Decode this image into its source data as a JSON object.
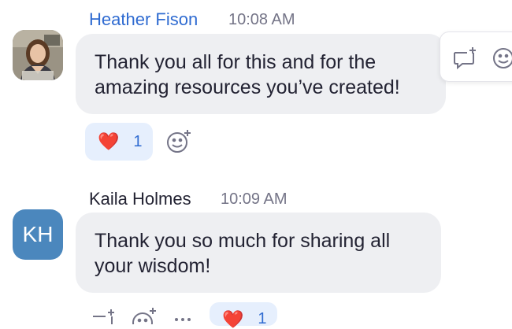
{
  "messages": [
    {
      "sender": "Heather Fison",
      "time": "10:08 AM",
      "text_lines": [
        "Thank you all for this and for the",
        "amazing resources you’ve created!"
      ],
      "reaction": {
        "emoji": "❤️",
        "count": "1"
      }
    },
    {
      "sender": "Kaila Holmes",
      "initials": "KH",
      "time": "10:09 AM",
      "text_lines": [
        "Thank you so much for sharing all",
        "your wisdom!"
      ],
      "reaction": {
        "emoji": "❤️",
        "count": "1"
      }
    }
  ],
  "colors": {
    "sender_highlight": "#2f6bd1",
    "bubble": "#eeeff2",
    "reaction_bg": "#e6effd",
    "avatar_kh": "#4b87bd"
  },
  "icons": [
    "reply-in-thread-icon",
    "add-reaction-icon",
    "more-icon",
    "heart-emoji"
  ]
}
